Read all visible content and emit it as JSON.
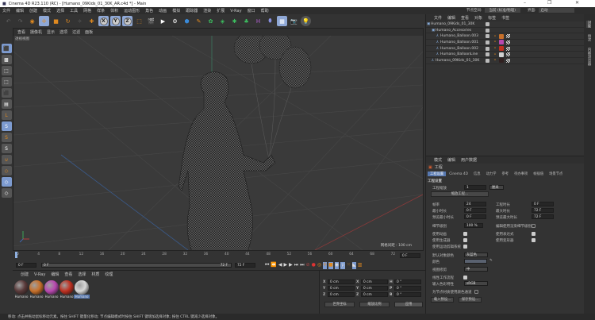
{
  "window": {
    "title": "Cinema 4D R23.110 (RC) - [Humano_09Kids_01_30K_AR.c4d *] - Main",
    "minimize": "–",
    "maximize": "❐",
    "close": "✕"
  },
  "menu": [
    "文件",
    "编辑",
    "创建",
    "模式",
    "选择",
    "工具",
    "网格",
    "样条",
    "体积",
    "运动图形",
    "角色",
    "动画",
    "模拟",
    "跟踪器",
    "渲染",
    "扩展",
    "V-Ray",
    "窗口",
    "帮助"
  ],
  "toolbar": {
    "axes": [
      "X",
      "Y",
      "Z"
    ]
  },
  "header_right": {
    "node_space_label": "节点空间:",
    "node_space_value": "当前 (标准/物理)",
    "layout_label": "界面:",
    "layout_value": "启动"
  },
  "viewport": {
    "menu": [
      "查看",
      "摄像机",
      "显示",
      "选项",
      "过滤",
      "面板"
    ],
    "label": "透视视图",
    "grid_spacing": "网格间距 : 100 cm"
  },
  "object_manager": {
    "menu": [
      "文件",
      "编辑",
      "查看",
      "对象",
      "标签",
      "书签"
    ],
    "objects": [
      {
        "name": "Humano_09Kids_01_30K",
        "indent": 0,
        "material": ""
      },
      {
        "name": "Humano_Accesories",
        "indent": 1,
        "material": ""
      },
      {
        "name": "Humano_Balloon.003",
        "indent": 2,
        "material": "#c8702a"
      },
      {
        "name": "Humano_Balloon.001",
        "indent": 2,
        "material": "#b848b0"
      },
      {
        "name": "Humano_Balloon.002",
        "indent": 2,
        "material": "#c03020"
      },
      {
        "name": "Humano_BalloonLine",
        "indent": 2,
        "material": "#d0d0d0"
      },
      {
        "name": "Humano_09Kids_01_30K",
        "indent": 1,
        "material": "#302020"
      }
    ]
  },
  "right_tabs": [
    "对象",
    "场次",
    "内容浏览器"
  ],
  "attributes": {
    "menu": [
      "模式",
      "编辑",
      "用户数据"
    ],
    "object": "工程",
    "tabs": [
      "工程设置",
      "Cinema 4D",
      "信息",
      "动力学",
      "参考",
      "待办事项",
      "帧插值",
      "场景节点"
    ],
    "section": "工程设置",
    "scale_label": "工程缩放",
    "scale_value": "1",
    "scale_unit": "厘米",
    "scale_button": "缩放工程...",
    "fps_label": "帧率",
    "fps": "24",
    "project_time_label": "工程时长",
    "project_time": "0 F",
    "min_time_label": "最小时长",
    "min_time": "0 F",
    "max_time_label": "最大时长",
    "max_time": "72 F",
    "prev_min_label": "预览最小时长",
    "prev_min": "0 F",
    "prev_max_label": "预览最大时长",
    "prev_max": "72 F",
    "lod_label": "细节级别",
    "lod": "100 %",
    "render_lod_label": "编辑使用渲染细节级别",
    "use_animation": "使用动画",
    "use_expressions": "使用表达式",
    "use_generators": "使用生成器",
    "use_deformers": "使用变形器",
    "use_motion": "使用运动剪辑系统",
    "default_color_label": "默认对象颜色",
    "default_color": "灰蓝色",
    "color_label": "颜色",
    "color_value": "#5a6270",
    "clipping_label": "视图修剪",
    "clipping": "中",
    "linear_label": "线性工作流程",
    "input_profile_label": "输入色彩特性",
    "input_profile": "sRGB",
    "node_color_label": "为节点材质使用颜色通道",
    "load_preset": "载入预设...",
    "save_preset": "保存预设..."
  },
  "timeline": {
    "ticks": [
      "0",
      "4",
      "8",
      "12",
      "16",
      "20",
      "24",
      "28",
      "32",
      "36",
      "40",
      "44",
      "48",
      "52",
      "56",
      "60",
      "64",
      "68",
      "72"
    ],
    "current": "0 F",
    "start": "0 F",
    "range_start": "0 F",
    "range_end": "72 F",
    "end": "72 F"
  },
  "material_manager": {
    "menu": [
      "创建",
      "V-Ray",
      "编辑",
      "查看",
      "选择",
      "材质",
      "纹理"
    ],
    "materials": [
      {
        "name": "Humano",
        "color": "#5a3a3a"
      },
      {
        "name": "Humano",
        "color": "#c8702a"
      },
      {
        "name": "Humano",
        "color": "#b848b0"
      },
      {
        "name": "Humano",
        "color": "#c03020"
      },
      {
        "name": "Humano",
        "color": "#d8d8d8"
      }
    ]
  },
  "coordinates": {
    "rows": [
      {
        "a": "X",
        "av": "0 cm",
        "b": "X",
        "bv": "0 cm",
        "c": "H",
        "cv": "0 °"
      },
      {
        "a": "Y",
        "av": "0 cm",
        "b": "Y",
        "bv": "0 cm",
        "c": "P",
        "cv": "0 °"
      },
      {
        "a": "Z",
        "av": "0 cm",
        "b": "Z",
        "bv": "0 cm",
        "c": "B",
        "cv": "0 °"
      }
    ],
    "mode": "世界坐标",
    "scale_mode": "缩放比例",
    "apply": "应用"
  },
  "status": "移动: 点击并拖动鼠标移动元素。按住 SHIFT 键量化移动; 节点编辑模式时按住 SHIFT 键增加选择对象; 按住 CTRL 键减少选择对象。"
}
